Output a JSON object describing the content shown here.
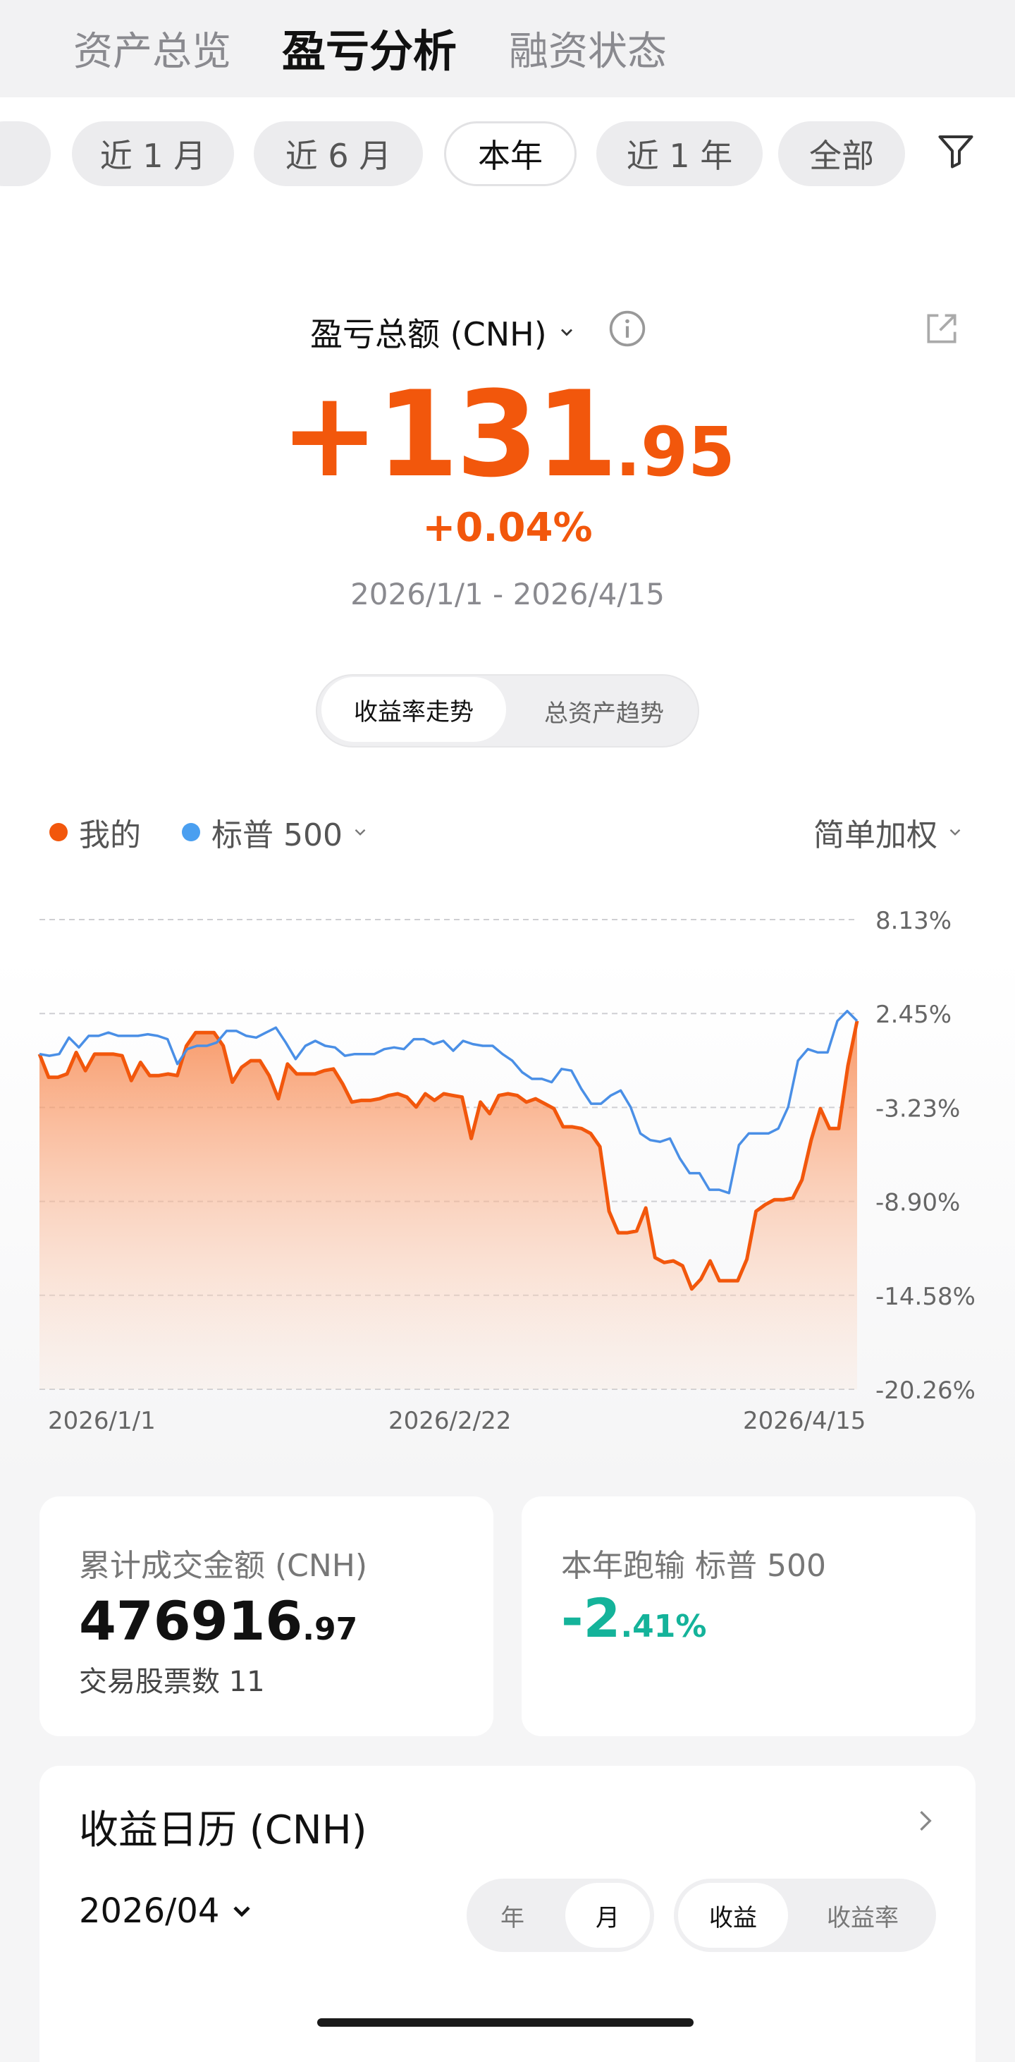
{
  "top_tabs": [
    {
      "label": "资产总览",
      "active": false
    },
    {
      "label": "盈亏分析",
      "active": true
    },
    {
      "label": "融资状态",
      "active": false
    }
  ],
  "period_filters": [
    {
      "label": "近 1 月",
      "active": false
    },
    {
      "label": "近 6 月",
      "active": false
    },
    {
      "label": "本年",
      "active": true
    },
    {
      "label": "近 1 年",
      "active": false
    },
    {
      "label": "全部",
      "active": false
    }
  ],
  "summary": {
    "metric_label": "盈亏总额 (CNH)",
    "value_int": "+131",
    "value_dec": ".95",
    "percent": "+0.04%",
    "date_range": "2026/1/1 - 2026/4/15"
  },
  "view_toggle": [
    {
      "label": "收益率走势",
      "active": true
    },
    {
      "label": "总资产趋势",
      "active": false
    }
  ],
  "legend": {
    "mine": "我的",
    "benchmark": "标普 500",
    "weighting": "简单加权"
  },
  "colors": {
    "accent_orange": "#f2570c",
    "benchmark_blue": "#4a8fe6",
    "gain_green": "#14b39a"
  },
  "chart_data": {
    "type": "line",
    "x_labels": [
      "2026/1/1",
      "2026/2/22",
      "2026/4/15"
    ],
    "y_ticks": [
      "8.13%",
      "2.45%",
      "-3.23%",
      "-8.90%",
      "-14.58%",
      "-20.26%"
    ],
    "ylim": [
      -20.26,
      8.13
    ],
    "grid": true,
    "series": [
      {
        "name": "我的",
        "color": "#f2570c",
        "fill": true,
        "values": [
          0.0,
          -1.4,
          -1.4,
          -1.2,
          0.1,
          -1.0,
          0.0,
          0.0,
          0.0,
          -0.1,
          -1.6,
          -0.5,
          -1.3,
          -1.3,
          -1.2,
          -1.3,
          0.5,
          1.3,
          1.3,
          1.3,
          0.5,
          -1.7,
          -0.8,
          -0.4,
          -0.4,
          -1.3,
          -2.7,
          -0.6,
          -1.2,
          -1.2,
          -1.2,
          -1.0,
          -0.9,
          -1.8,
          -2.9,
          -2.8,
          -2.8,
          -2.7,
          -2.5,
          -2.4,
          -2.6,
          -3.2,
          -2.4,
          -2.8,
          -2.4,
          -2.5,
          -2.6,
          -5.1,
          -2.9,
          -3.6,
          -2.5,
          -2.4,
          -2.5,
          -2.9,
          -2.7,
          -3.0,
          -3.3,
          -4.4,
          -4.4,
          -4.5,
          -4.8,
          -5.6,
          -9.5,
          -10.8,
          -10.8,
          -10.7,
          -9.3,
          -12.3,
          -12.6,
          -12.5,
          -12.8,
          -14.2,
          -13.6,
          -12.5,
          -13.7,
          -13.7,
          -13.7,
          -12.4,
          -9.5,
          -9.1,
          -8.8,
          -8.8,
          -8.7,
          -7.6,
          -5.2,
          -3.3,
          -4.5,
          -4.5,
          -0.7,
          2.0
        ]
      },
      {
        "name": "标普 500",
        "color": "#4a8fe6",
        "fill": false,
        "values": [
          0.0,
          -0.1,
          0.0,
          1.0,
          0.4,
          1.1,
          1.1,
          1.3,
          1.1,
          1.1,
          1.1,
          1.2,
          1.1,
          0.9,
          -0.6,
          0.3,
          0.5,
          0.5,
          0.7,
          1.4,
          1.4,
          1.1,
          1.0,
          1.3,
          1.6,
          0.7,
          -0.3,
          0.5,
          0.8,
          0.5,
          0.4,
          -0.1,
          0.0,
          0.0,
          0.0,
          0.3,
          0.4,
          0.3,
          0.9,
          0.9,
          0.6,
          0.8,
          0.2,
          0.8,
          0.6,
          0.5,
          0.5,
          0.0,
          -0.4,
          -1.1,
          -1.5,
          -1.5,
          -1.7,
          -0.9,
          -1.0,
          -2.1,
          -3.0,
          -3.0,
          -2.5,
          -2.2,
          -3.2,
          -4.8,
          -5.2,
          -5.3,
          -5.1,
          -6.3,
          -7.2,
          -7.2,
          -8.2,
          -8.2,
          -8.4,
          -5.5,
          -4.8,
          -4.8,
          -4.8,
          -4.5,
          -3.2,
          -0.4,
          0.3,
          0.1,
          0.1,
          2.0,
          2.6,
          2.0
        ]
      }
    ]
  },
  "cards": {
    "turnover_label": "累计成交金额 (CNH)",
    "turnover_int": "476916",
    "turnover_dec": ".97",
    "stocks_label": "交易股票数 11",
    "vs_label": "本年跑输 标普 500",
    "vs_int": "-2",
    "vs_dec": ".41%"
  },
  "calendar": {
    "title": "收益日历 (CNH)",
    "month": "2026/04",
    "period_toggle": [
      "年",
      "月"
    ],
    "period_active": "月",
    "metric_toggle": [
      "收益",
      "收益率"
    ],
    "metric_active": "收益"
  }
}
